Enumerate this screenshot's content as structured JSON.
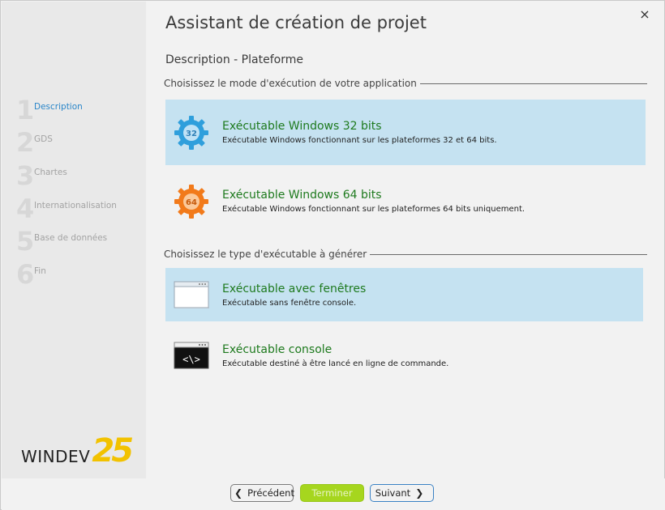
{
  "wizard": {
    "title": "Assistant de création de projet",
    "subtitle": "Description - Plateforme",
    "close_label": "×"
  },
  "steps": [
    {
      "num": "1",
      "label": "Description",
      "active": true
    },
    {
      "num": "2",
      "label": "GDS",
      "active": false
    },
    {
      "num": "3",
      "label": "Chartes",
      "active": false
    },
    {
      "num": "4",
      "label": "Internationalisation",
      "active": false
    },
    {
      "num": "5",
      "label": "Base de données",
      "active": false
    },
    {
      "num": "6",
      "label": "Fin",
      "active": false
    }
  ],
  "logo": {
    "text": "WINDEV",
    "version": "25"
  },
  "section1": {
    "title": "Choisissez le mode d'exécution de votre application",
    "options": [
      {
        "title": "Exécutable Windows 32 bits",
        "desc": "Exécutable Windows fonctionnant sur les plateformes 32 et 64 bits.",
        "icon_label": "32",
        "selected": true
      },
      {
        "title": "Exécutable Windows 64 bits",
        "desc": "Exécutable Windows fonctionnant sur les plateformes 64 bits uniquement.",
        "icon_label": "64",
        "selected": false
      }
    ]
  },
  "section2": {
    "title": "Choisissez le type d'exécutable à générer",
    "options": [
      {
        "title": "Exécutable avec fenêtres",
        "desc": "Exécutable sans fenêtre console.",
        "selected": true
      },
      {
        "title": "Exécutable console",
        "desc": "Exécutable destiné à être lancé en ligne de commande.",
        "icon_label": "<\\>",
        "selected": false
      }
    ]
  },
  "footer": {
    "prev_label": "Précédent",
    "finish_label": "Terminer",
    "next_label": "Suivant",
    "prev_glyph": "❮",
    "next_glyph": "❯"
  },
  "colors": {
    "selected_bg": "#c5e2f1",
    "option_title": "#1e7a1e",
    "active_step": "#2a86c9",
    "finish_button": "#a6d61e",
    "gear_32": "#2f9fdc",
    "gear_64": "#f27a1a",
    "logo_accent": "#f2c200"
  }
}
